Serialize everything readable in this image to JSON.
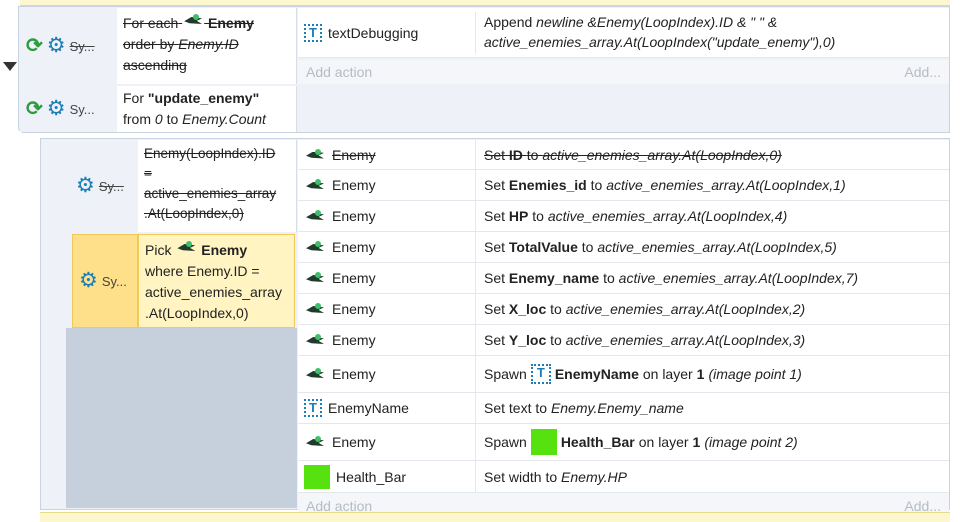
{
  "colors": {
    "accent": "#1b7fb5",
    "green_sprite": "#56e20e",
    "selected_bg": "#fff4c2",
    "selected_border": "#f1c95a"
  },
  "event1": {
    "system_label_1": "Sy...",
    "system_label_2": "Sy...",
    "cond1": {
      "p1": "For each",
      "obj": "Enemy",
      "p2": "order by",
      "expr": "Enemy.ID",
      "p3": "ascending"
    },
    "cond2": {
      "p1": "For",
      "quoted": "\"update_enemy\"",
      "p2": "from",
      "from": "0",
      "p3": "to",
      "to": "Enemy.Count"
    },
    "action": {
      "object": "textDebugging",
      "verb": "Append",
      "expr": "newline &Enemy(LoopIndex).ID & \" \" & active_enemies_array.At(LoopIndex(\"update_enemy\"),0)"
    },
    "add_action": "Add action",
    "add_more": "Add..."
  },
  "event2": {
    "system_label_1": "Sy...",
    "system_label_2": "Sy...",
    "cond1": {
      "line1": "Enemy(LoopIndex).ID",
      "line2": "=",
      "line3": "active_enemies_array",
      "line4": ".At(LoopIndex,0)"
    },
    "cond2": {
      "p1": "Pick",
      "obj": "Enemy",
      "line2": "where Enemy.ID =",
      "line3": "active_enemies_array",
      "line4": ".At(LoopIndex,0)"
    },
    "actions": [
      {
        "object": "Enemy",
        "pre": "Set",
        "bold": "ID",
        "mid": "to",
        "expr": "active_enemies_array.At(LoopIndex,0)",
        "post": ""
      },
      {
        "object": "Enemy",
        "pre": "Set",
        "bold": "Enemies_id",
        "mid": "to",
        "expr": "active_enemies_array.At(LoopIndex,1)",
        "post": ""
      },
      {
        "object": "Enemy",
        "pre": "Set",
        "bold": "HP",
        "mid": "to",
        "expr": "active_enemies_array.At(LoopIndex,4)",
        "post": ""
      },
      {
        "object": "Enemy",
        "pre": "Set",
        "bold": "TotalValue",
        "mid": "to",
        "expr": "active_enemies_array.At(LoopIndex,5)",
        "post": ""
      },
      {
        "object": "Enemy",
        "pre": "Set",
        "bold": "Enemy_name",
        "mid": "to",
        "expr": "active_enemies_array.At(LoopIndex,7)",
        "post": ""
      },
      {
        "object": "Enemy",
        "pre": "Set",
        "bold": "X_loc",
        "mid": "to",
        "expr": "active_enemies_array.At(LoopIndex,2)",
        "post": ""
      },
      {
        "object": "Enemy",
        "pre": "Set",
        "bold": "Y_loc",
        "mid": "to",
        "expr": "active_enemies_array.At(LoopIndex,3)",
        "post": ""
      }
    ],
    "spawn1": {
      "object": "Enemy",
      "pre": "Spawn",
      "target": "EnemyName",
      "mid": "on layer",
      "layer": "1",
      "post": "(image point 1)"
    },
    "settext": {
      "object": "EnemyName",
      "pre": "Set text to",
      "expr": "Enemy.Enemy_name"
    },
    "spawn2": {
      "object": "Enemy",
      "pre": "Spawn",
      "target": "Health_Bar",
      "mid": "on layer",
      "layer": "1",
      "post": "(image point 2)"
    },
    "setwidth": {
      "object": "Health_Bar",
      "pre": "Set width to",
      "expr": "Enemy.HP"
    },
    "add_action": "Add action",
    "add_more": "Add..."
  }
}
